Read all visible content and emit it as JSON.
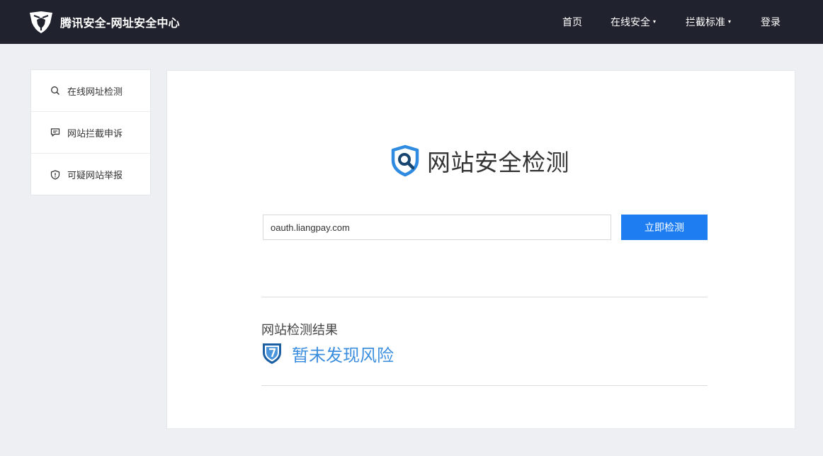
{
  "header": {
    "brand_title": "腾讯安全-网址安全中心",
    "nav": [
      {
        "label": "首页",
        "has_dropdown": false
      },
      {
        "label": "在线安全",
        "has_dropdown": true
      },
      {
        "label": "拦截标准",
        "has_dropdown": true
      },
      {
        "label": "登录",
        "has_dropdown": false
      }
    ],
    "dropdown_caret": "▾"
  },
  "sidebar": {
    "items": [
      {
        "label": "在线网址检测",
        "icon": "search-icon"
      },
      {
        "label": "网站拦截申诉",
        "icon": "message-icon"
      },
      {
        "label": "可疑网站举报",
        "icon": "shield-alert-icon"
      }
    ]
  },
  "main": {
    "title": "网站安全检测",
    "search": {
      "value": "oauth.liangpay.com",
      "placeholder": "",
      "button_label": "立即检测"
    },
    "result": {
      "label": "网站检测结果",
      "status": "暂未发现风险",
      "status_icon": "safe-shield-icon"
    }
  },
  "colors": {
    "topbar": "#20232e",
    "accent": "#1e7ef1",
    "result_text": "#3c8edf",
    "page_bg": "#eeeff3"
  }
}
